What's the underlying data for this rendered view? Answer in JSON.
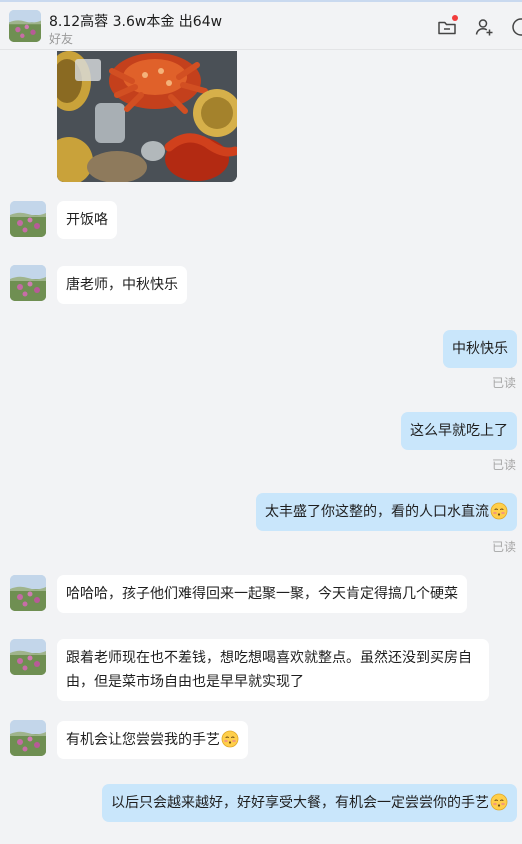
{
  "header": {
    "title": "8.12高蓉 3.6w本金 出64w",
    "subtitle": "好友"
  },
  "icons": {
    "folder": "folder-icon",
    "add_user": "add-user-icon",
    "more": "more-icon",
    "notification_dot_color": "#f23c3c"
  },
  "colors": {
    "incoming_bubble": "#ffffff",
    "outgoing_bubble": "#c9e6fb",
    "background": "#f2f3f5"
  },
  "messages": [
    {
      "side": "in",
      "type": "image",
      "content": "crab-feast-photo"
    },
    {
      "side": "in",
      "text": "开饭咯"
    },
    {
      "side": "in",
      "text": "唐老师，中秋快乐"
    },
    {
      "side": "out",
      "text": "中秋快乐",
      "status": "已读"
    },
    {
      "side": "out",
      "text": "这么早就吃上了",
      "status": "已读"
    },
    {
      "side": "out",
      "text": "太丰盛了你这整的，看的人口水直流",
      "emoji": "shy-emoji",
      "status": "已读"
    },
    {
      "side": "in",
      "text": "哈哈哈，孩子他们难得回来一起聚一聚，今天肯定得搞几个硬菜"
    },
    {
      "side": "in",
      "text": "跟着老师现在也不差钱，想吃想喝喜欢就整点。虽然还没到买房自由，但是菜市场自由也是早早就实现了"
    },
    {
      "side": "in",
      "text": "有机会让您尝尝我的手艺",
      "emoji": "shy-emoji"
    },
    {
      "side": "out",
      "text": "以后只会越来越好，好好享受大餐，有机会一定尝尝你的手艺",
      "emoji": "shy-emoji"
    }
  ]
}
